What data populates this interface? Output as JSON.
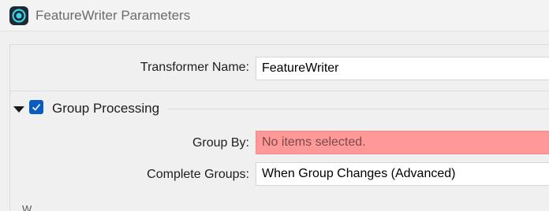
{
  "window": {
    "title": "FeatureWriter Parameters",
    "icon": "fme-app-icon"
  },
  "transformer": {
    "label": "Transformer Name:",
    "value": "FeatureWriter"
  },
  "group_processing": {
    "label": "Group Processing",
    "checked": true,
    "expanded": true,
    "group_by": {
      "label": "Group By:",
      "placeholder": "No items selected.",
      "status_color": "#ff9999"
    },
    "complete_groups": {
      "label": "Complete Groups:",
      "selected": "When Group Changes (Advanced)"
    }
  },
  "colors": {
    "accent": "#0a5cc2",
    "error_field": "#ff9999"
  }
}
